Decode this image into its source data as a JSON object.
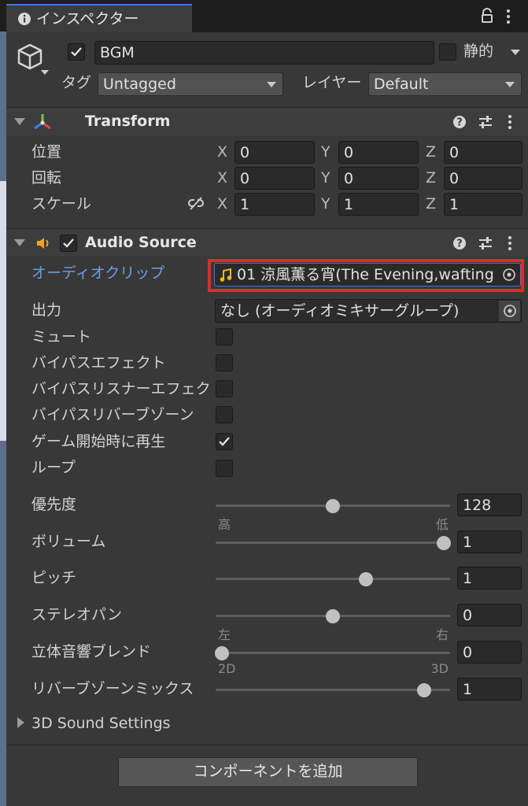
{
  "tab": {
    "title": "インスペクター",
    "icon": "info-icon"
  },
  "gameobject": {
    "enabled": true,
    "name": "BGM",
    "static_label": "静的",
    "static": false,
    "tag_label": "タグ",
    "tag_value": "Untagged",
    "layer_label": "レイヤー",
    "layer_value": "Default"
  },
  "transform": {
    "title": "Transform",
    "rows": [
      {
        "label": "位置",
        "x": "0",
        "y": "0",
        "z": "0"
      },
      {
        "label": "回転",
        "x": "0",
        "y": "0",
        "z": "0"
      },
      {
        "label": "スケール",
        "x": "1",
        "y": "1",
        "z": "1"
      }
    ],
    "axis_x": "X",
    "axis_y": "Y",
    "axis_z": "Z"
  },
  "audio": {
    "title": "Audio Source",
    "enabled": true,
    "clip_label": "オーディオクリップ",
    "clip_value": "01 涼風薫る宵(The Evening,wafting",
    "output_label": "出力",
    "output_value": "なし (オーディオミキサーグループ)",
    "toggles": [
      {
        "label": "ミュート",
        "checked": false
      },
      {
        "label": "バイパスエフェクト",
        "checked": false
      },
      {
        "label": "バイパスリスナーエフェク",
        "checked": false
      },
      {
        "label": "バイパスリバーブゾーン",
        "checked": false
      },
      {
        "label": "ゲーム開始時に再生",
        "checked": true
      },
      {
        "label": "ループ",
        "checked": false
      }
    ],
    "sliders": [
      {
        "label": "優先度",
        "value": "128",
        "fraction": 0.5,
        "min_label": "高",
        "max_label": "低"
      },
      {
        "label": "ボリューム",
        "value": "1",
        "fraction": 1.0,
        "min_label": "",
        "max_label": ""
      },
      {
        "label": "ピッチ",
        "value": "1",
        "fraction": 0.65,
        "min_label": "",
        "max_label": ""
      },
      {
        "label": "ステレオパン",
        "value": "0",
        "fraction": 0.5,
        "min_label": "左",
        "max_label": "右"
      },
      {
        "label": "立体音響ブレンド",
        "value": "0",
        "fraction": 0.0,
        "min_label": "2D",
        "max_label": "3D"
      },
      {
        "label": "リバーブゾーンミックス",
        "value": "1",
        "fraction": 0.91,
        "min_label": "",
        "max_label": ""
      }
    ],
    "sound_settings_label": "3D Sound Settings"
  },
  "add_component_label": "コンポーネントを追加",
  "colors": {
    "highlight": "#e02a2a",
    "label_blue": "#6a9ee6",
    "accent": "#3a79d6"
  }
}
